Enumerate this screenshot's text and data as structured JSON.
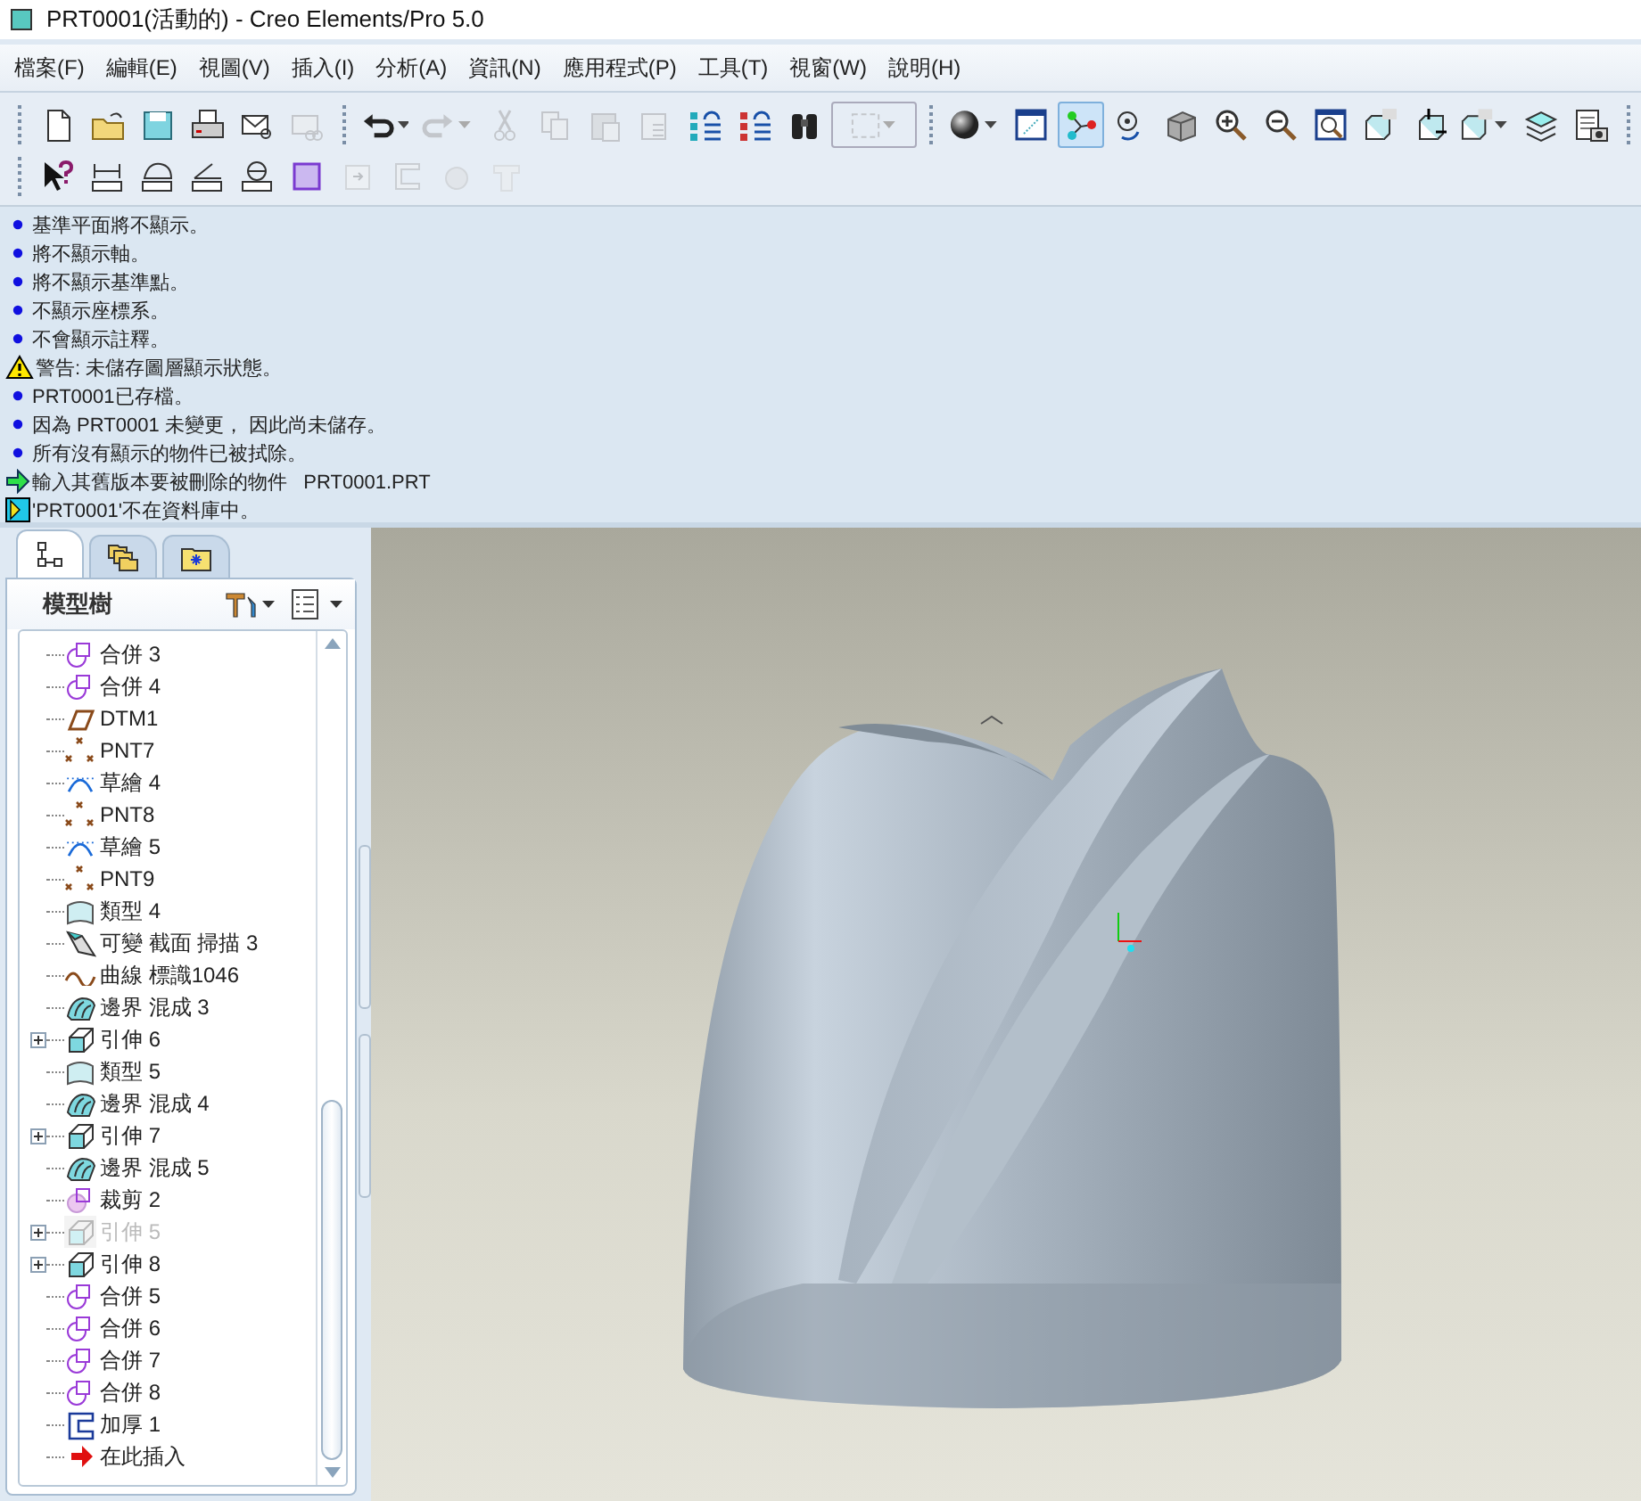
{
  "window": {
    "title": "PRT0001(活動的) - Creo Elements/Pro 5.0"
  },
  "menu": [
    "檔案(F)",
    "編輯(E)",
    "視圖(V)",
    "插入(I)",
    "分析(A)",
    "資訊(N)",
    "應用程式(P)",
    "工具(T)",
    "視窗(W)",
    "說明(H)"
  ],
  "toolbar_rows": [
    [
      {
        "kind": "new",
        "disabled": false,
        "selected": false,
        "menu": false
      },
      {
        "kind": "open",
        "disabled": false,
        "selected": false,
        "menu": false
      },
      {
        "kind": "save",
        "disabled": false,
        "selected": false,
        "menu": false
      },
      {
        "kind": "print",
        "disabled": false,
        "selected": false,
        "menu": false
      },
      {
        "kind": "mail",
        "disabled": false,
        "selected": false,
        "menu": false
      },
      {
        "kind": "mail-link",
        "disabled": true,
        "selected": false,
        "menu": false
      },
      {
        "kind": "separator"
      },
      {
        "kind": "undo",
        "disabled": false,
        "selected": false,
        "menu": true
      },
      {
        "kind": "redo",
        "disabled": true,
        "selected": false,
        "menu": true
      },
      {
        "kind": "cut",
        "disabled": true,
        "selected": false,
        "menu": false
      },
      {
        "kind": "copy",
        "disabled": true,
        "selected": false,
        "menu": false
      },
      {
        "kind": "paste",
        "disabled": true,
        "selected": false,
        "menu": false
      },
      {
        "kind": "paste-special",
        "disabled": true,
        "selected": false,
        "menu": false
      },
      {
        "kind": "regenerate",
        "disabled": false,
        "selected": false,
        "menu": false
      },
      {
        "kind": "regen-manager",
        "disabled": false,
        "selected": false,
        "menu": false
      },
      {
        "kind": "find",
        "disabled": false,
        "selected": false,
        "menu": false
      },
      {
        "kind": "select-box",
        "disabled": true,
        "selected": false,
        "menu": true
      },
      {
        "kind": "separator"
      },
      {
        "kind": "shading",
        "disabled": false,
        "selected": false,
        "menu": true
      },
      {
        "kind": "saved-view",
        "disabled": false,
        "selected": false,
        "menu": false
      },
      {
        "kind": "datum-display",
        "disabled": false,
        "selected": true,
        "menu": false
      },
      {
        "kind": "spin-center",
        "disabled": false,
        "selected": false,
        "menu": false
      },
      {
        "kind": "orient",
        "disabled": false,
        "selected": false,
        "menu": false
      },
      {
        "kind": "zoom-in",
        "disabled": false,
        "selected": false,
        "menu": false
      },
      {
        "kind": "zoom-out",
        "disabled": false,
        "selected": false,
        "menu": false
      },
      {
        "kind": "refit",
        "disabled": false,
        "selected": false,
        "menu": false
      },
      {
        "kind": "named-view",
        "disabled": false,
        "selected": false,
        "menu": false
      },
      {
        "kind": "reorient",
        "disabled": false,
        "selected": false,
        "menu": false
      },
      {
        "kind": "named-view",
        "disabled": false,
        "selected": false,
        "menu": true
      },
      {
        "kind": "layers",
        "disabled": false,
        "selected": false,
        "menu": false
      },
      {
        "kind": "view-manager",
        "disabled": false,
        "selected": false,
        "menu": false
      },
      {
        "kind": "separator"
      }
    ],
    [
      {
        "kind": "whats-this",
        "disabled": false,
        "selected": false,
        "menu": false
      },
      {
        "kind": "measure-distance",
        "disabled": false,
        "selected": false,
        "menu": false
      },
      {
        "kind": "measure-length",
        "disabled": false,
        "selected": false,
        "menu": false
      },
      {
        "kind": "measure-angle",
        "disabled": false,
        "selected": false,
        "menu": false
      },
      {
        "kind": "measure-diameter",
        "disabled": false,
        "selected": false,
        "menu": false
      },
      {
        "kind": "hatch",
        "disabled": false,
        "selected": false,
        "menu": false
      },
      {
        "kind": "insert",
        "disabled": true,
        "selected": false,
        "menu": false
      },
      {
        "kind": "bracket",
        "disabled": true,
        "selected": false,
        "menu": false
      },
      {
        "kind": "round",
        "disabled": true,
        "selected": false,
        "menu": false
      },
      {
        "kind": "shell",
        "disabled": true,
        "selected": false,
        "menu": false
      }
    ]
  ],
  "messages": [
    {
      "kind": "info",
      "text": "基準平面將不顯示。"
    },
    {
      "kind": "info",
      "text": "將不顯示軸。"
    },
    {
      "kind": "info",
      "text": "將不顯示基準點。"
    },
    {
      "kind": "info",
      "text": "不顯示座標系。"
    },
    {
      "kind": "info",
      "text": "不會顯示註釋。"
    },
    {
      "kind": "warning",
      "text": "警告: 未儲存圖層顯示狀態。"
    },
    {
      "kind": "info",
      "text": "PRT0001已存檔。"
    },
    {
      "kind": "info",
      "text": "因為 PRT0001 未變更， 因此尚未儲存。"
    },
    {
      "kind": "info",
      "text": "所有沒有顯示的物件已被拭除。"
    },
    {
      "kind": "prompt",
      "text": "輸入其舊版本要被刪除的物件   PRT0001.PRT"
    },
    {
      "kind": "error",
      "text": "'PRT0001'不在資料庫中。"
    }
  ],
  "panel_tabs": [
    {
      "kind": "tree",
      "selected": true
    },
    {
      "kind": "folders",
      "selected": false
    },
    {
      "kind": "favorites",
      "selected": false
    }
  ],
  "model_tree": {
    "title": "模型樹",
    "items": [
      {
        "kind": "merge",
        "label": "合併 3",
        "expandable": false,
        "suppressed": false
      },
      {
        "kind": "merge",
        "label": "合併 4",
        "expandable": false,
        "suppressed": false
      },
      {
        "kind": "datum-plane",
        "label": "DTM1",
        "expandable": false,
        "suppressed": false
      },
      {
        "kind": "point",
        "label": "PNT7",
        "expandable": false,
        "suppressed": false
      },
      {
        "kind": "sketch",
        "label": "草繪 4",
        "expandable": false,
        "suppressed": false
      },
      {
        "kind": "point",
        "label": "PNT8",
        "expandable": false,
        "suppressed": false
      },
      {
        "kind": "sketch",
        "label": "草繪 5",
        "expandable": false,
        "suppressed": false
      },
      {
        "kind": "point",
        "label": "PNT9",
        "expandable": false,
        "suppressed": false
      },
      {
        "kind": "style",
        "label": "類型 4",
        "expandable": false,
        "suppressed": false
      },
      {
        "kind": "sweep",
        "label": "可變 截面 掃描 3",
        "expandable": false,
        "suppressed": false
      },
      {
        "kind": "curve",
        "label": "曲線 標識1046",
        "expandable": false,
        "suppressed": false
      },
      {
        "kind": "boundary",
        "label": "邊界 混成 3",
        "expandable": false,
        "suppressed": false
      },
      {
        "kind": "extrude",
        "label": "引伸 6",
        "expandable": true,
        "suppressed": false
      },
      {
        "kind": "style",
        "label": "類型 5",
        "expandable": false,
        "suppressed": false
      },
      {
        "kind": "boundary",
        "label": "邊界 混成 4",
        "expandable": false,
        "suppressed": false
      },
      {
        "kind": "extrude",
        "label": "引伸 7",
        "expandable": true,
        "suppressed": false
      },
      {
        "kind": "boundary",
        "label": "邊界 混成 5",
        "expandable": false,
        "suppressed": false
      },
      {
        "kind": "trim",
        "label": "裁剪 2",
        "expandable": false,
        "suppressed": false
      },
      {
        "kind": "extrude",
        "label": "引伸 5",
        "expandable": true,
        "suppressed": true
      },
      {
        "kind": "extrude",
        "label": "引伸 8",
        "expandable": true,
        "suppressed": false
      },
      {
        "kind": "merge",
        "label": "合併 5",
        "expandable": false,
        "suppressed": false
      },
      {
        "kind": "merge",
        "label": "合併 6",
        "expandable": false,
        "suppressed": false
      },
      {
        "kind": "merge",
        "label": "合併 7",
        "expandable": false,
        "suppressed": false
      },
      {
        "kind": "merge",
        "label": "合併 8",
        "expandable": false,
        "suppressed": false
      },
      {
        "kind": "thicken",
        "label": "加厚 1",
        "expandable": false,
        "suppressed": false
      },
      {
        "kind": "insert-here",
        "label": "在此插入",
        "expandable": false,
        "suppressed": false
      }
    ]
  }
}
